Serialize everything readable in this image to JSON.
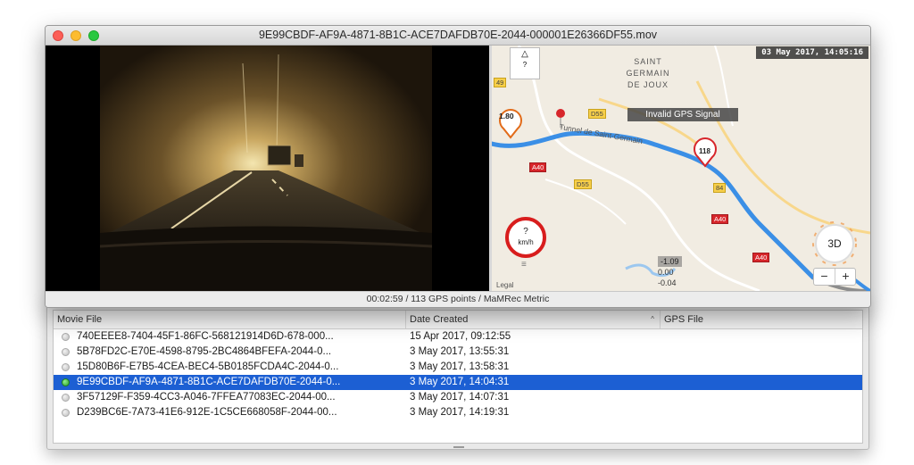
{
  "player": {
    "title": "9E99CBDF-AF9A-4871-8B1C-ACE7DAFDB70E-2044-000001E26366DF55.mov",
    "status": "00:02:59 / 113 GPS points / MaMRec Metric"
  },
  "map": {
    "timestamp": "03 May 2017, 14:05:16",
    "gps_banner": "Invalid GPS Signal",
    "unknown_box": "?",
    "speed_value": "?",
    "speed_unit": "km/h",
    "marker_left": "1.80",
    "marker_right": "118",
    "legal": "Legal",
    "values": [
      "-1.09",
      "0.00",
      "-0.04"
    ],
    "button_3d": "3D",
    "zoom_out": "−",
    "zoom_in": "+",
    "town": [
      "SAINT",
      "GERMAIN",
      "DE JOUX"
    ],
    "tunnel_label": "Tunnel de Saint-Germain",
    "road_labels": {
      "d55_top": "D55",
      "d55_bottom": "D55",
      "a40_left": "A40",
      "a40_mid": "A40",
      "a40_right": "A40",
      "n84": "84",
      "r49": "49"
    }
  },
  "file_list": {
    "columns": [
      "Movie File",
      "Date Created",
      "GPS File"
    ],
    "sort_indicator": "^",
    "rows": [
      {
        "file": "740EEEE8-7404-45F1-86FC-568121914D6D-678-000...",
        "date": "15 Apr 2017, 09:12:55",
        "status": "none"
      },
      {
        "file": "5B78FD2C-E70E-4598-8795-2BC4864BFEFA-2044-0...",
        "date": "3 May 2017, 13:55:31",
        "status": "none"
      },
      {
        "file": "15D80B6F-E7B5-4CEA-BEC4-5B0185FCDA4C-2044-0...",
        "date": "3 May 2017, 13:58:31",
        "status": "none"
      },
      {
        "file": "9E99CBDF-AF9A-4871-8B1C-ACE7DAFDB70E-2044-0...",
        "date": "3 May 2017, 14:04:31",
        "status": "active",
        "selected": true
      },
      {
        "file": "3F57129F-F359-4CC3-A046-7FFEA77083EC-2044-00...",
        "date": "3 May 2017, 14:07:31",
        "status": "none"
      },
      {
        "file": "D239BC6E-7A73-41E6-912E-1C5CE668058F-2044-00...",
        "date": "3 May 2017, 14:19:31",
        "status": "none"
      }
    ]
  },
  "colors": {
    "selection": "#1c5fd3",
    "route": "#3b8fe6",
    "speed_ring": "#d81d1d",
    "marker_orange": "#e26b19",
    "marker_red": "#d7262b"
  }
}
